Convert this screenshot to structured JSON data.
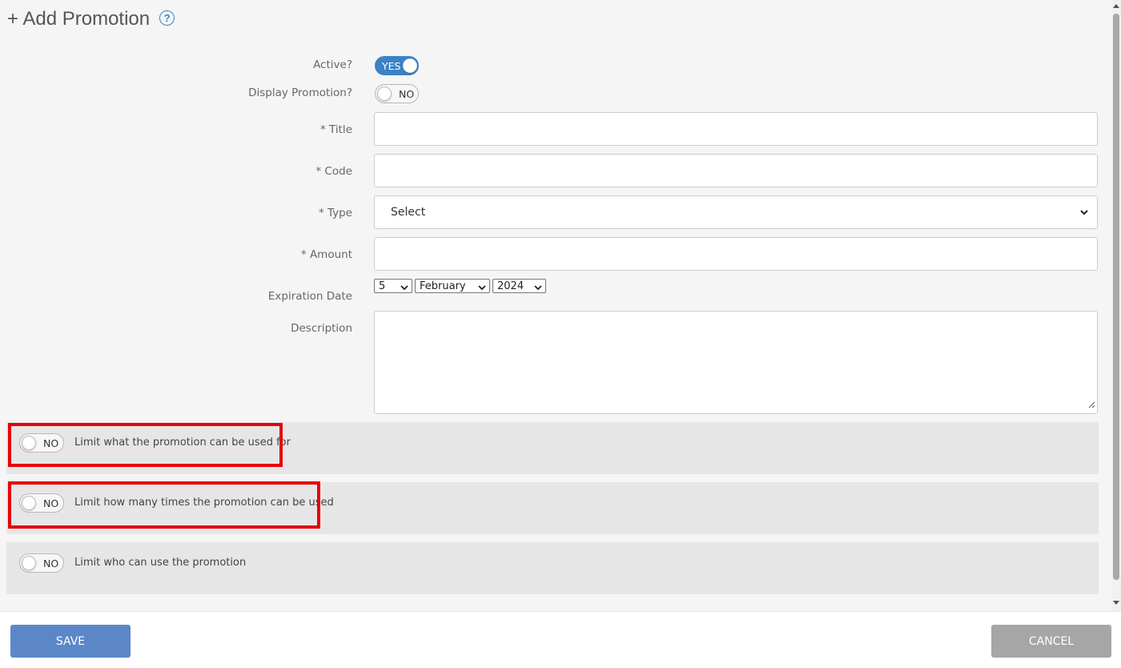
{
  "header": {
    "title": "+ Add Promotion",
    "help_icon": "question-circle-icon"
  },
  "form": {
    "active": {
      "label": "Active?",
      "state": "YES"
    },
    "display_promotion": {
      "label": "Display Promotion?",
      "state": "NO"
    },
    "title": {
      "label": "* Title",
      "value": ""
    },
    "code": {
      "label": "* Code",
      "value": ""
    },
    "type": {
      "label": "* Type",
      "selected": "Select"
    },
    "amount": {
      "label": "* Amount",
      "value": ""
    },
    "expiration": {
      "label": "Expiration Date",
      "day": "5",
      "month": "February",
      "year": "2024"
    },
    "description": {
      "label": "Description",
      "value": ""
    }
  },
  "limits": [
    {
      "state": "NO",
      "label": "Limit what the promotion can be used for",
      "highlighted": true
    },
    {
      "state": "NO",
      "label": "Limit how many times the promotion can be used",
      "highlighted": true
    },
    {
      "state": "NO",
      "label": "Limit who can use the promotion",
      "highlighted": false
    }
  ],
  "footer": {
    "save_label": "SAVE",
    "cancel_label": "CANCEL"
  },
  "colors": {
    "accent": "#3b82c4",
    "save_button": "#5b87c9",
    "cancel_button": "#a6a6a6",
    "highlight": "#e8000b"
  }
}
